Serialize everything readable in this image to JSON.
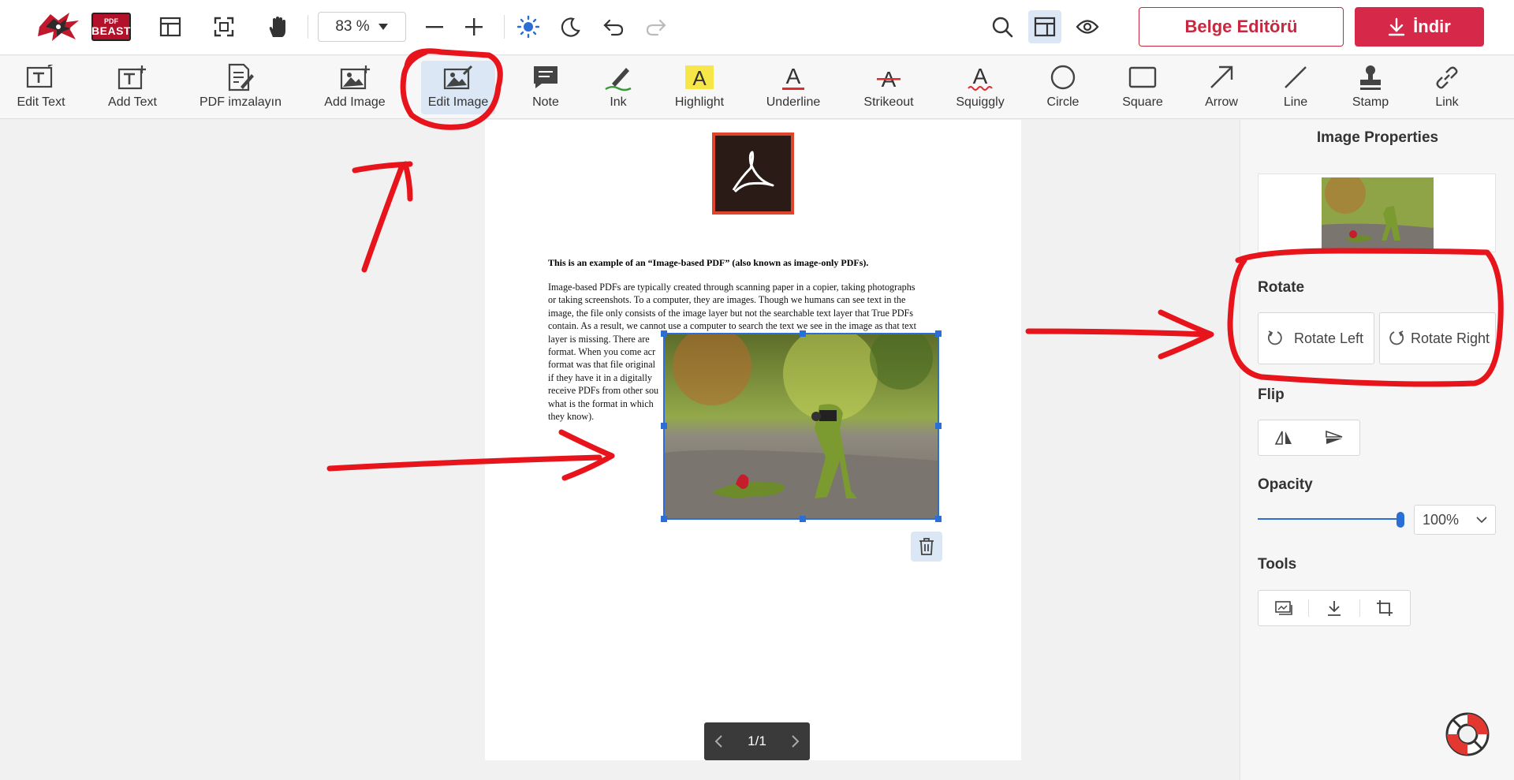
{
  "app": {
    "brand_small": "PDF",
    "brand_large": "BEAST"
  },
  "topbar": {
    "zoom": "83 %",
    "editor_button": "Belge Editörü",
    "download_button": "İndir"
  },
  "tools": [
    {
      "label": "Edit Text",
      "icon": "edit-text-icon"
    },
    {
      "label": "Add Text",
      "icon": "add-text-icon"
    },
    {
      "label": "PDF imzalayın",
      "icon": "sign-pdf-icon"
    },
    {
      "label": "Add Image",
      "icon": "add-image-icon"
    },
    {
      "label": "Edit Image",
      "icon": "edit-image-icon"
    },
    {
      "label": "Note",
      "icon": "note-icon"
    },
    {
      "label": "Ink",
      "icon": "ink-icon"
    },
    {
      "label": "Highlight",
      "icon": "highlight-icon"
    },
    {
      "label": "Underline",
      "icon": "underline-icon"
    },
    {
      "label": "Strikeout",
      "icon": "strikeout-icon"
    },
    {
      "label": "Squiggly",
      "icon": "squiggly-icon"
    },
    {
      "label": "Circle",
      "icon": "circle-icon"
    },
    {
      "label": "Square",
      "icon": "square-icon"
    },
    {
      "label": "Arrow",
      "icon": "arrow-icon"
    },
    {
      "label": "Line",
      "icon": "line-icon"
    },
    {
      "label": "Stamp",
      "icon": "stamp-icon"
    },
    {
      "label": "Link",
      "icon": "link-icon"
    }
  ],
  "document": {
    "title": "This is an example of an “Image-based PDF” (also known as image-only PDFs).",
    "body": [
      "Image-based PDFs are typically created through scanning paper in a copier, taking photographs",
      "or taking screenshots. To a computer, they are images. Though we humans can see text in the",
      "image, the file only consists of the image layer but not the searchable text layer that True PDFs",
      "contain. As a result, we cannot use a computer to search the text we see in the image as that text",
      "layer is missing. There are",
      "format. When you come acr",
      "format was that file original",
      "if they have it in a digitally",
      "receive PDFs from other sou",
      "what is the format in which",
      "they know)."
    ],
    "page_indicator": "1/1"
  },
  "panel": {
    "title": "Image Properties",
    "rotate_label": "Rotate",
    "rotate_left": "Rotate Left",
    "rotate_right": "Rotate Right",
    "flip_label": "Flip",
    "opacity_label": "Opacity",
    "opacity_value": "100%",
    "opacity": 1.0,
    "tools_label": "Tools"
  },
  "colors": {
    "accent": "#d6294a",
    "selection": "#2a6ed6",
    "annotation": "#e8141c"
  }
}
